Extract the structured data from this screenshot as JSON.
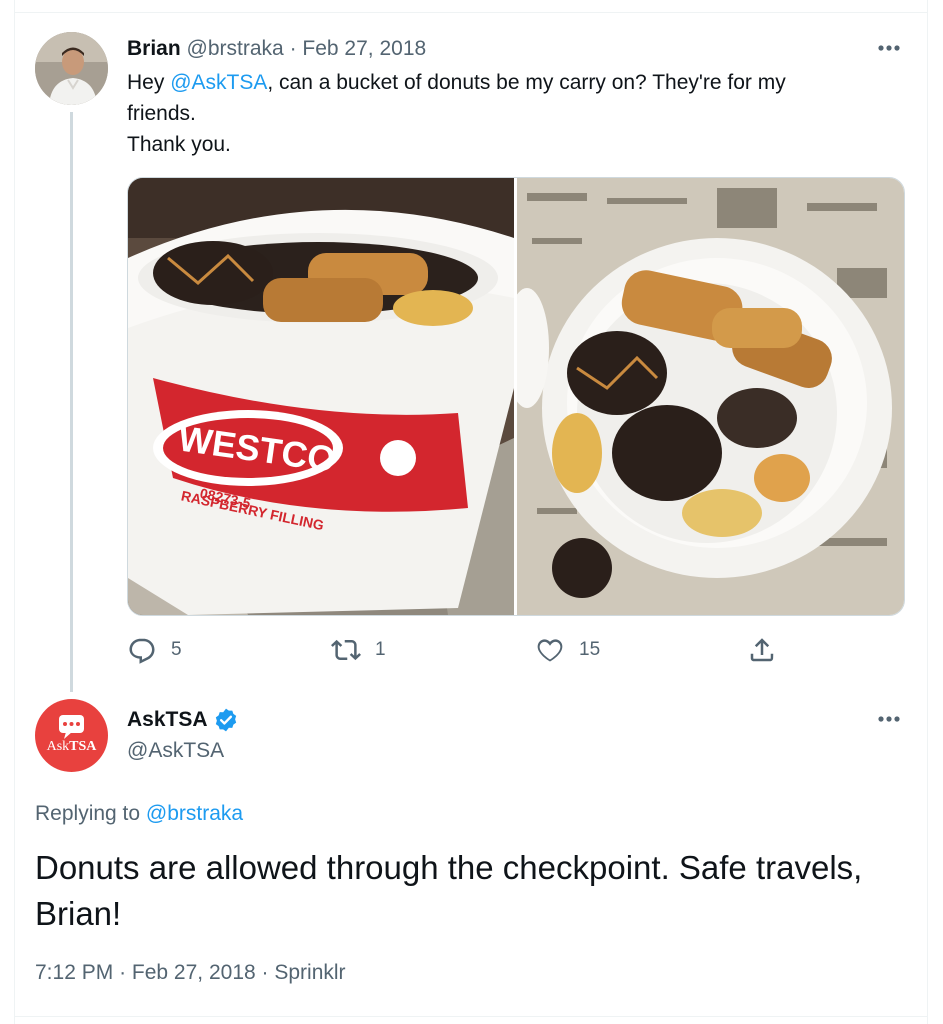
{
  "tweet1": {
    "name": "Brian",
    "handle": "@brstraka",
    "separator": "·",
    "date": "Feb 27, 2018",
    "text_pre": "Hey ",
    "mention": "@AskTSA",
    "text_post": ", can a bucket of donuts be my carry on? They're for my",
    "text_line2": "friends.",
    "text_line3": "Thank you.",
    "photos": [
      {
        "label_lines": [
          "WESTCO",
          "08273-5",
          "RASPBERRY FILLING"
        ],
        "bucket_color": "#ffffff",
        "logo_color": "#d3262e"
      },
      {
        "label_lines": []
      }
    ],
    "actions": {
      "replies": "5",
      "retweets": "1",
      "likes": "15"
    },
    "icons": [
      "reply-icon",
      "retweet-icon",
      "like-icon",
      "share-icon",
      "more-icon"
    ]
  },
  "tweet2": {
    "name": "AskTSA",
    "handle": "@AskTSA",
    "verified": true,
    "avatar_text_a": "Ask",
    "avatar_text_b": "TSA",
    "avatar_color": "#e8413e",
    "replying_prefix": "Replying to ",
    "replying_to": "@brstraka",
    "text": "Donuts are allowed through the checkpoint. Safe travels, Brian!",
    "time": "7:12 PM",
    "date": "Feb 27, 2018",
    "source": "Sprinklr",
    "separator": "·"
  },
  "colors": {
    "accent": "#1d9bf0",
    "muted": "#536471",
    "text": "#0f1419"
  }
}
